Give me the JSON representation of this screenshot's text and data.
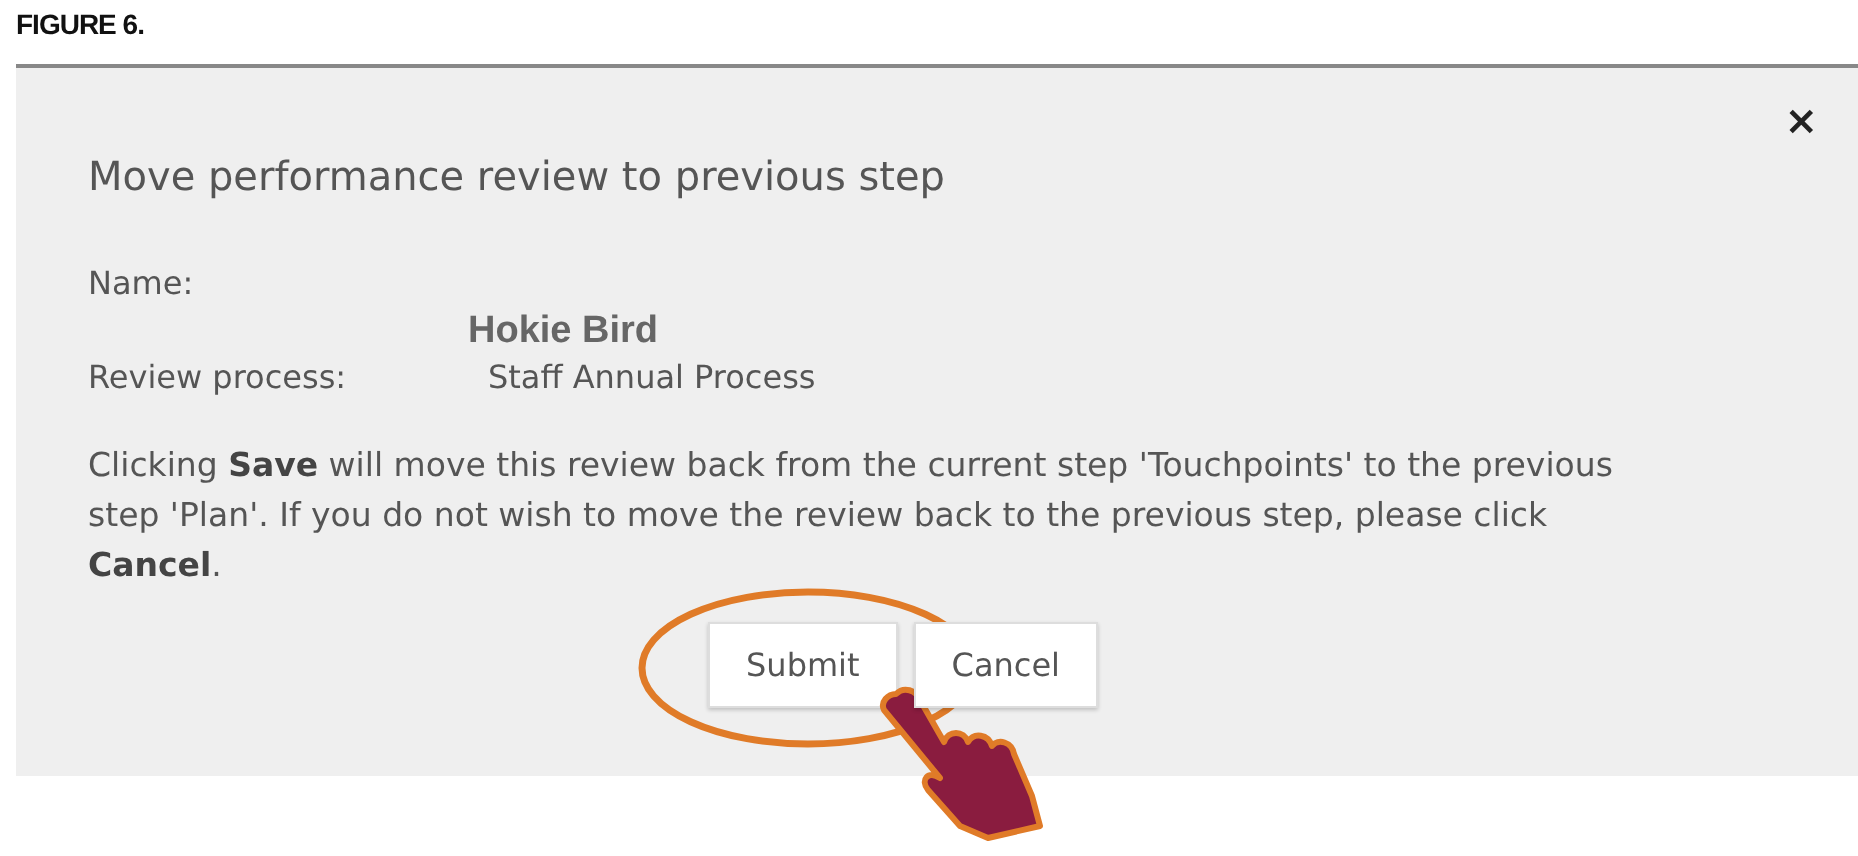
{
  "figure_label": "FIGURE 6.",
  "dialog": {
    "title": "Move performance review to previous step",
    "close": "×",
    "fields": [
      {
        "label": "Name:",
        "value": "Hokie Bird",
        "emphasized": true
      },
      {
        "label": "Review process:",
        "value": "Staff Annual Process",
        "emphasized": false
      }
    ],
    "message": "Clicking **Save** will move this review back from the current step 'Touchpoints' to the previous step 'Plan'. If you do not wish to move the review back to the previous step, please click **Cancel**.",
    "buttons": [
      {
        "label": "Submit",
        "highlighted": true
      },
      {
        "label": "Cancel",
        "highlighted": false
      }
    ]
  }
}
